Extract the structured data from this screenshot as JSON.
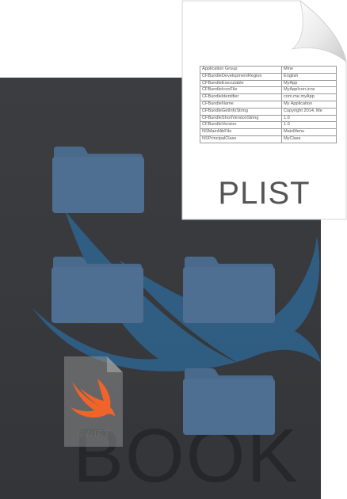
{
  "book": {
    "title": "BOOK"
  },
  "swift_file": {
    "label": "SWIFT",
    "icon": "swift-logo-icon"
  },
  "folders": [
    {
      "icon": "folder-icon"
    },
    {
      "icon": "folder-icon"
    },
    {
      "icon": "folder-icon"
    },
    {
      "icon": "folder-icon"
    }
  ],
  "plist": {
    "label": "PLIST",
    "rows": [
      {
        "key": "Application Group",
        "value": "Mine"
      },
      {
        "key": "CFBundleDevelopmentRegion",
        "value": "English"
      },
      {
        "key": "CFBundleExecutable",
        "value": "MyApp"
      },
      {
        "key": "CFBundleIconFile",
        "value": "MyAppIcon.icns"
      },
      {
        "key": "CFBundleIdentifier",
        "value": "com.me.myApp"
      },
      {
        "key": "CFBundleName",
        "value": "My Application"
      },
      {
        "key": "CFBundleGetInfoString",
        "value": "Copyright 2014, Me"
      },
      {
        "key": "CFBundleShortVersionString",
        "value": "1.0"
      },
      {
        "key": "CFBundleVersion",
        "value": "1.0"
      },
      {
        "key": "NSMainNibFile",
        "value": "MainMenu"
      },
      {
        "key": "NSPrincipalClass",
        "value": "MyClass"
      }
    ]
  },
  "colors": {
    "book_background": "#3a3c3f",
    "swift_bird": "#2f5f86",
    "folder_body": "#4e6f92",
    "folder_tab": "#4a6a8c",
    "swift_orange": "#f0642a"
  }
}
